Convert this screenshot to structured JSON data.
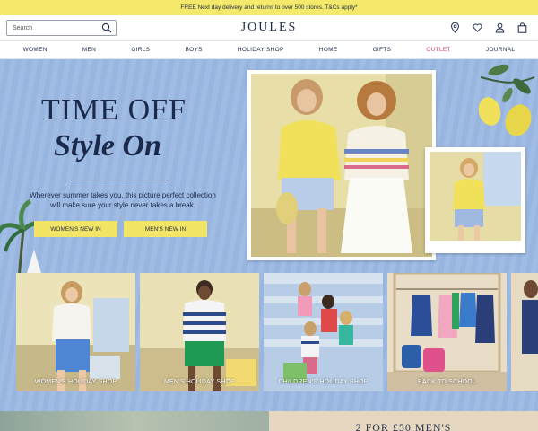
{
  "promo": {
    "text": "FREE Next day delivery and returns to over 500 stores. T&Cs apply*"
  },
  "header": {
    "search_placeholder": "Search",
    "logo": "JOULES",
    "icons": [
      "store-locator-icon",
      "wishlist-heart-icon",
      "account-icon",
      "bag-icon"
    ]
  },
  "nav": {
    "items": [
      "WOMEN",
      "MEN",
      "GIRLS",
      "BOYS",
      "HOLIDAY SHOP",
      "HOME",
      "GIFTS",
      "OUTLET",
      "JOURNAL"
    ]
  },
  "hero": {
    "headline_line1": "TIME OFF",
    "headline_line2": "Style On",
    "subcopy": "Wherever summer takes you, this picture perfect collection will make sure your style never takes a break.",
    "buttons": [
      "WOMEN'S NEW IN",
      "MEN'S NEW IN"
    ]
  },
  "categories": [
    {
      "label": "WOMEN'S HOLIDAY SHOP"
    },
    {
      "label": "MEN'S HOLIDAY SHOP"
    },
    {
      "label": "CHILDREN'S HOLIDAY SHOP"
    },
    {
      "label": "BACK TO SCHOOL"
    }
  ],
  "promo2": {
    "text": "2 FOR £50 MEN'S"
  },
  "colors": {
    "promo_bg": "#f4e96a",
    "hero_bg": "#9bb9e3",
    "navy": "#1b2a4a",
    "outlet": "#d64064",
    "button_yellow": "#f2e566"
  }
}
